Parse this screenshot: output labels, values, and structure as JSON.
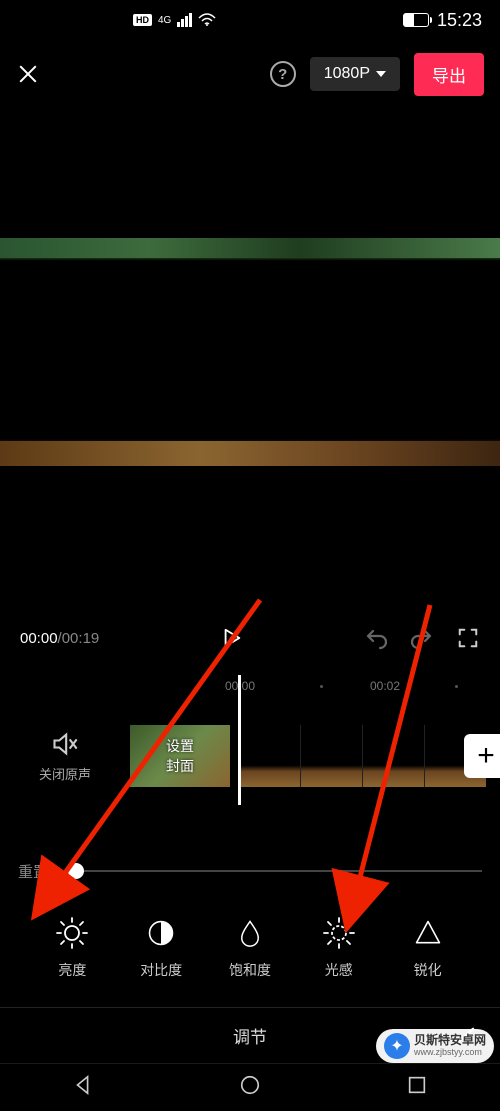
{
  "status": {
    "hd": "HD",
    "net": "4G",
    "battery_pct": "41",
    "time": "15:23"
  },
  "topbar": {
    "resolution": "1080P",
    "export": "导出"
  },
  "playback": {
    "current": "00:00",
    "total": "00:19"
  },
  "ruler": {
    "t1": "00:00",
    "t2": "00:02"
  },
  "timeline": {
    "mute_label": "关闭原声",
    "cover_label": "设置\n封面"
  },
  "adjust": {
    "reset": "重置",
    "tools": [
      {
        "label": "亮度"
      },
      {
        "label": "对比度"
      },
      {
        "label": "饱和度"
      },
      {
        "label": "光感"
      },
      {
        "label": "锐化"
      }
    ]
  },
  "bottom": {
    "title": "调节"
  },
  "watermark": {
    "name": "贝斯特安卓网",
    "url": "www.zjbstyy.com"
  }
}
